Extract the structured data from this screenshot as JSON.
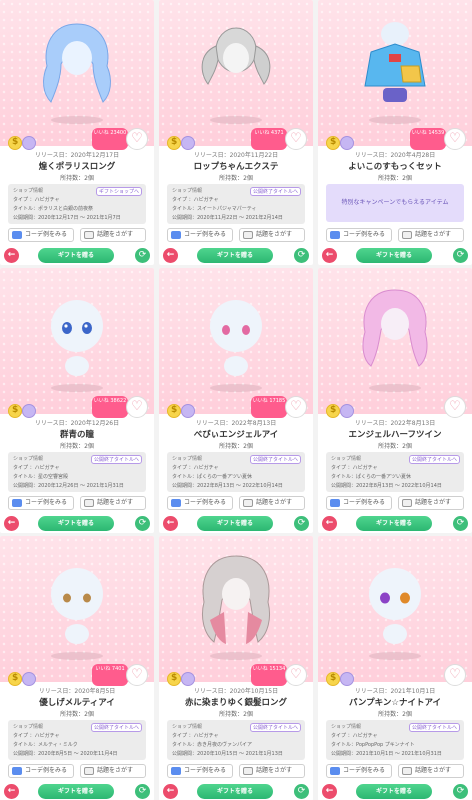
{
  "cards": [
    {
      "release": "リリース日：2020年12月17日",
      "name": "煌くポラリスロング",
      "owned": "所持数：2個",
      "badge": "いいね 23400",
      "shop": {
        "header": "ショップ情報",
        "tag": "ギフトショップへ",
        "type": "タイプ ：ハピガチャ",
        "title": "タイトル：ポラリスと白銀の前夜祭",
        "period": "公開期間：2020年12月17日 〜 2021年1月7日"
      },
      "special": null,
      "coord_button": "コーデ例をみる",
      "topic_button": "話題をさがす",
      "gift_button": "ギフトを贈る",
      "art": "hair-blue"
    },
    {
      "release": "リリース日：2020年11月22日",
      "name": "ロップちゃんエクステ",
      "owned": "所持数：2個",
      "badge": "いいね 4371",
      "shop": {
        "header": "ショップ情報",
        "tag": "公開終了タイトルへ",
        "type": "タイプ ：ハピガチャ",
        "title": "タイトル：スイートパジャマパーティ",
        "period": "公開期間：2020年11月22日 〜 2021年2月14日"
      },
      "special": null,
      "coord_button": "コーデ例をみる",
      "topic_button": "話題をさがす",
      "gift_button": "ギフトを贈る",
      "art": "hair-gray"
    },
    {
      "release": "リリース日：2020年4月28日",
      "name": "よいこのすもっくセット",
      "owned": "所持数：2個",
      "badge": "いいね 14539",
      "shop": null,
      "special": "特別なキャンペーンでもらえるアイテム",
      "coord_button": "コーデ例をみる",
      "topic_button": "話題をさがす",
      "gift_button": "ギフトを贈る",
      "art": "smock"
    },
    {
      "release": "リリース日：2020年12月26日",
      "name": "群青の瞳",
      "owned": "所持数：2個",
      "badge": "いいね 38622",
      "shop": {
        "header": "ショップ情報",
        "tag": "公開終了タイトルへ",
        "type": "タイプ ：ハピガチャ",
        "title": "タイトル：星の空響宮殿",
        "period": "公開期間：2020年12月26日 〜 2021年1月31日"
      },
      "special": null,
      "coord_button": "コーデ例をみる",
      "topic_button": "話題をさがす",
      "gift_button": "ギフトを贈る",
      "art": "eyes-blue"
    },
    {
      "release": "リリース日：2022年8月13日",
      "name": "べびぃエンジェルアイ",
      "owned": "所持数：2個",
      "badge": "いいね 17185",
      "shop": {
        "header": "ショップ情報",
        "tag": "公開終了タイトルへ",
        "type": "タイプ ：ハピガチャ",
        "title": "タイトル：ぱくらの一番アツい夏休",
        "period": "公開期間：2022年8月13日 〜 2022年10月14日"
      },
      "special": null,
      "coord_button": "コーデ例をみる",
      "topic_button": "話題をさがす",
      "gift_button": "ギフトを贈る",
      "art": "eyes-pink"
    },
    {
      "release": "リリース日：2022年8月13日",
      "name": "エンジェルハーフツイン",
      "owned": "所持数：2個",
      "badge": "",
      "shop": {
        "header": "ショップ情報",
        "tag": "公開終了タイトルへ",
        "type": "タイプ ：ハピガチャ",
        "title": "タイトル：ぱくらの一番アツい夏休",
        "period": "公開期間：2022年8月13日 〜 2022年10月14日"
      },
      "special": null,
      "coord_button": "コーデ例をみる",
      "topic_button": "話題をさがす",
      "gift_button": "ギフトを贈る",
      "art": "hair-pink"
    },
    {
      "release": "リリース日：2020年8月5日",
      "name": "優しげメルティアイ",
      "owned": "所持数：2個",
      "badge": "いいね 7401",
      "shop": {
        "header": "ショップ情報",
        "tag": "公開終了タイトルへ",
        "type": "タイプ ：ハピガチャ",
        "title": "タイトル：メルティ・ミルク",
        "period": "公開期間：2020年8月5日 〜 2020年11月4日"
      },
      "special": null,
      "coord_button": "コーデ例をみる",
      "topic_button": "話題をさがす",
      "gift_button": "ギフトを贈る",
      "art": "eyes-gold"
    },
    {
      "release": "リリース日：2020年10月15日",
      "name": "赤に染まりゆく銀髪ロング",
      "owned": "所持数：2個",
      "badge": "いいね 15134",
      "shop": {
        "header": "ショップ情報",
        "tag": "公開終了タイトルへ",
        "type": "タイプ ：ハピガチャ",
        "title": "タイトル：赤き月夜のヴァンパイア",
        "period": "公開期間：2020年10月15日 〜 2021年1月13日"
      },
      "special": null,
      "coord_button": "コーデ例をみる",
      "topic_button": "話題をさがす",
      "gift_button": "ギフトを贈る",
      "art": "hair-silver"
    },
    {
      "release": "リリース日：2021年10月1日",
      "name": "パンプキン☆ナイトアイ",
      "owned": "所持数：2個",
      "badge": "",
      "shop": {
        "header": "ショップ情報",
        "tag": "公開終了タイトルへ",
        "type": "タイプ ：ハピガチャ",
        "title": "タイトル：PopPopPop プキンナイト",
        "period": "公開期間：2021年10月1日 〜 2021年10月31日"
      },
      "special": null,
      "coord_button": "コーデ例をみる",
      "topic_button": "話題をさがす",
      "gift_button": "ギフトを贈る",
      "art": "eyes-purple"
    }
  ]
}
